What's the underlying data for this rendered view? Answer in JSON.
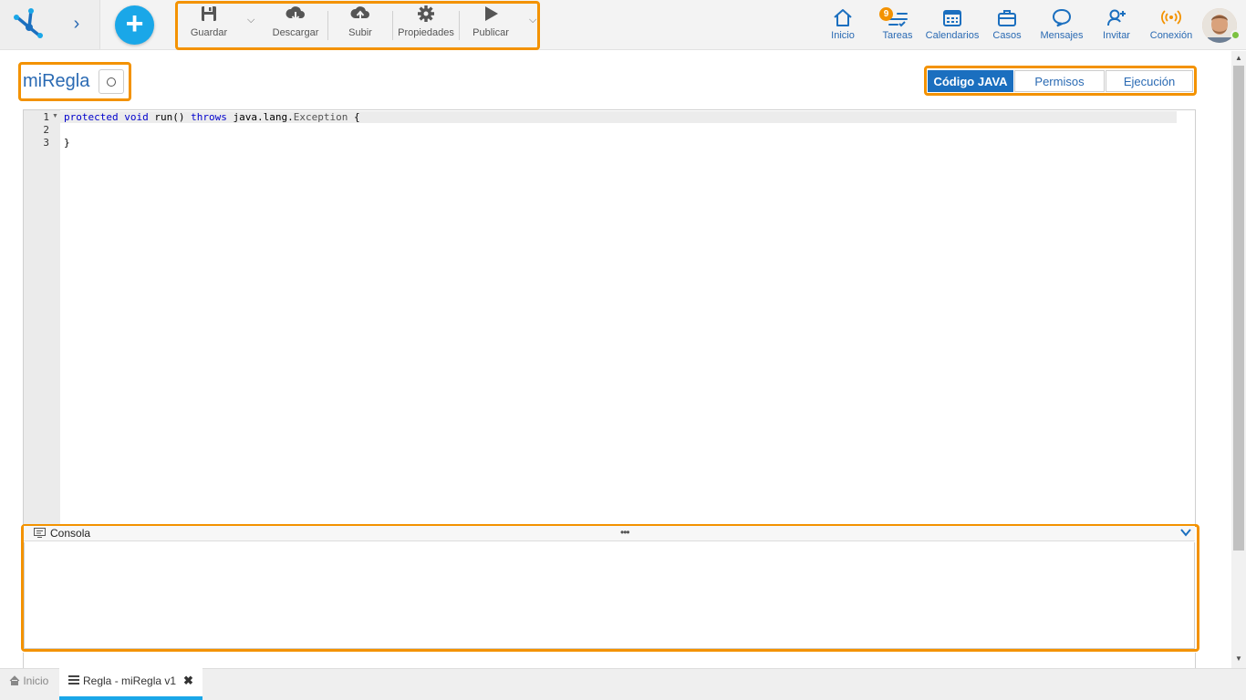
{
  "toolbar": {
    "save": "Guardar",
    "download": "Descargar",
    "upload": "Subir",
    "properties": "Propiedades",
    "publish": "Publicar"
  },
  "nav": {
    "home": "Inicio",
    "tasks": "Tareas",
    "tasks_count": "9",
    "calendars": "Calendarios",
    "cases": "Casos",
    "messages": "Mensajes",
    "invite": "Invitar",
    "connection": "Conexión"
  },
  "page": {
    "title": "miRegla"
  },
  "tabs": [
    {
      "label": "Código JAVA",
      "active": true
    },
    {
      "label": "Permisos",
      "active": false
    },
    {
      "label": "Ejecución",
      "active": false
    }
  ],
  "editor": {
    "line_numbers": [
      "1",
      "2",
      "3"
    ],
    "code": {
      "kw1": "protected",
      "kw2": "void",
      "method": "run()",
      "kw3": "throws",
      "pkg": "java.lang.",
      "cls": "Exception",
      "brace_open": "{",
      "brace_close": "}"
    }
  },
  "console": {
    "title": "Consola",
    "dots": "•••"
  },
  "bottom_tabs": {
    "home": "Inicio",
    "active_tab": "Regla - miRegla v1",
    "close": "✖"
  },
  "colors": {
    "accent": "#f39200",
    "primary": "#2a6ab3",
    "active_tab": "#1b6fbf",
    "add_button": "#1aa7e8"
  }
}
